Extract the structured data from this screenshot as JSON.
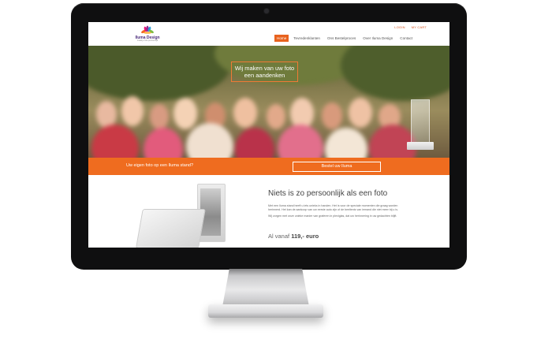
{
  "site": {
    "logo": {
      "name": "Iluma Design",
      "tagline": "maak je foto persoonlijk"
    },
    "topbar": [
      "LOGIN",
      "MY CART"
    ],
    "nav": [
      {
        "label": "Home",
        "active": true
      },
      {
        "label": "Tevredenklanten",
        "active": false
      },
      {
        "label": "Ons Bestelproces",
        "active": false
      },
      {
        "label": "Over Iluma Design",
        "active": false
      },
      {
        "label": "Contact",
        "active": false
      }
    ],
    "hero": {
      "line1": "Wij maken van uw foto",
      "line2": "een aandenken"
    },
    "cta": {
      "text": "Uw eigen foto op een Iluma stand?",
      "button": "Bestel uw Iluma"
    },
    "content": {
      "title": "Niets is zo persoonlijk als een foto",
      "para1": "Met een Iluma stand heeft u iets unieks in handen. Het is voor de speciale momenten die graag worden herinnerd. Het kan de aankoop van uw eerste auto zijn of de beeltenis van iemand die niet meer bij u is.",
      "para2": "Wij zorgen met onze unieke manier van graferen in plexiglas, dat uw herinnering in uw gedachten blijft.",
      "price_prefix": "Al vanaf",
      "price_value": "119,- euro"
    }
  },
  "colors": {
    "accent": "#ef6c1f",
    "monitor_bezel": "#0f0f10"
  }
}
